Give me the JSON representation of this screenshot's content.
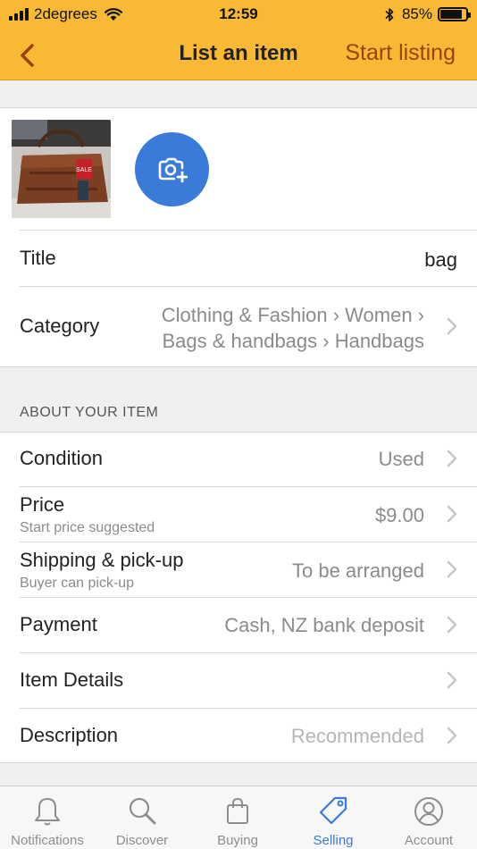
{
  "status_bar": {
    "carrier": "2degrees",
    "time": "12:59",
    "battery_percent": "85%",
    "battery_level": 0.85
  },
  "nav": {
    "title": "List an item",
    "action_label": "Start listing",
    "back_icon": "chevron-left-icon"
  },
  "photo": {
    "thumbnail_label": "SALE",
    "add_icon": "add-photo-icon"
  },
  "fields": {
    "title": {
      "label": "Title",
      "value": "bag"
    },
    "category": {
      "label": "Category",
      "value_line1": "Clothing & Fashion › Women ›",
      "value_line2": "Bags & handbags › Handbags"
    }
  },
  "about": {
    "header": "ABOUT YOUR ITEM",
    "rows": [
      {
        "label": "Condition",
        "value": "Used"
      },
      {
        "label": "Price",
        "sublabel": "Start price suggested",
        "value": "$9.00"
      },
      {
        "label": "Shipping & pick-up",
        "sublabel": "Buyer can pick-up",
        "value": "To be arranged"
      },
      {
        "label": "Payment",
        "value": "Cash, NZ bank deposit"
      },
      {
        "label": "Item Details",
        "value": ""
      },
      {
        "label": "Description",
        "value": "Recommended"
      }
    ]
  },
  "tabs": [
    {
      "label": "Notifications",
      "icon": "bell-icon",
      "active": false
    },
    {
      "label": "Discover",
      "icon": "search-icon",
      "active": false
    },
    {
      "label": "Buying",
      "icon": "shopping-bag-icon",
      "active": false
    },
    {
      "label": "Selling",
      "icon": "price-tag-icon",
      "active": true
    },
    {
      "label": "Account",
      "icon": "user-circle-icon",
      "active": false
    }
  ],
  "colors": {
    "brand_yellow": "#f8b934",
    "action_brown": "#9a4312",
    "accent_blue": "#3a7ad9"
  }
}
